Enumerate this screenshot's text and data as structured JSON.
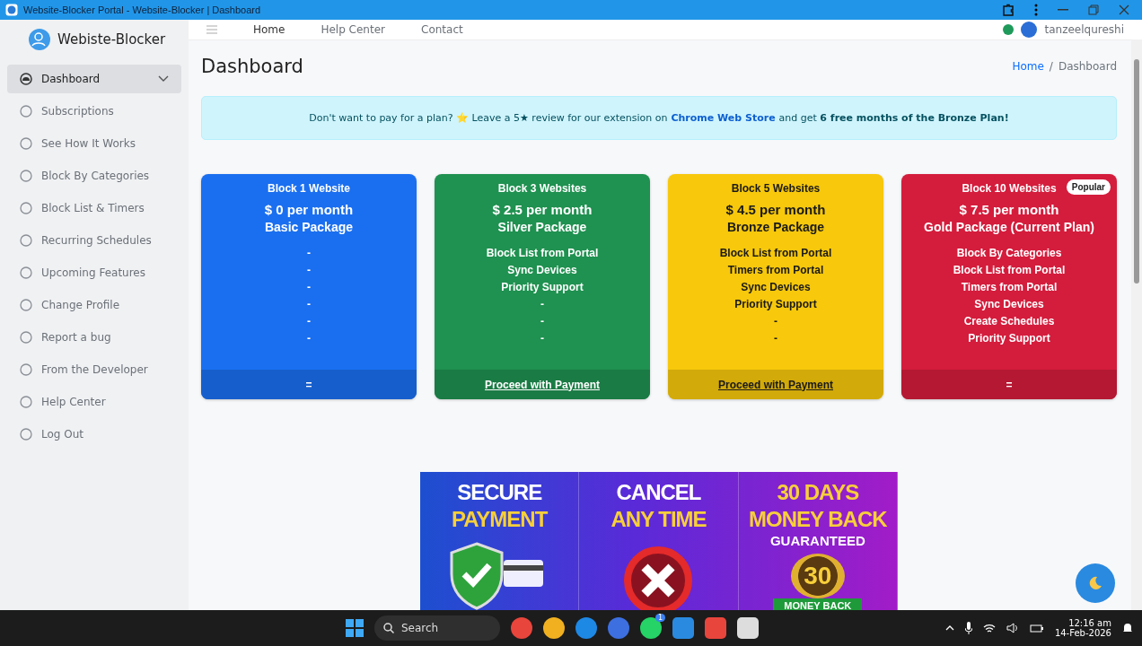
{
  "browser": {
    "title": "Website-Blocker Portal - Website-Blocker | Dashboard"
  },
  "sidebar": {
    "brand": "Webiste-Blocker",
    "items": [
      {
        "label": "Dashboard",
        "selected": true
      },
      {
        "label": "Subscriptions",
        "selected": false
      },
      {
        "label": "See How It Works",
        "selected": false
      },
      {
        "label": "Block By Categories",
        "selected": false
      },
      {
        "label": "Block List & Timers",
        "selected": false
      },
      {
        "label": "Recurring Schedules",
        "selected": false
      },
      {
        "label": "Upcoming Features",
        "selected": false
      },
      {
        "label": "Change Profile",
        "selected": false
      },
      {
        "label": "Report a bug",
        "selected": false
      },
      {
        "label": "From the Developer",
        "selected": false
      },
      {
        "label": "Help Center",
        "selected": false
      },
      {
        "label": "Log Out",
        "selected": false
      }
    ]
  },
  "topnav": {
    "links": [
      "Home",
      "Help Center",
      "Contact"
    ],
    "user": "tanzeelqureshi"
  },
  "page": {
    "title": "Dashboard",
    "breadcrumb": [
      "Home",
      "Dashboard"
    ],
    "separator": "/"
  },
  "notice": {
    "before": "Don't want to pay for a plan? ⭐ Leave a 5★ review for our extension on",
    "link": "Chrome Web Store",
    "after": "and get **6 free months of the Bronze Plan!**"
  },
  "plans": [
    {
      "title": "Block 1 Website",
      "price": "$ 0 per month",
      "package": "Basic Package",
      "color": "#1a6ff0",
      "features": [
        "-",
        "-",
        "-",
        "-",
        "-",
        "-"
      ],
      "footer": {
        "kind": "text",
        "text": "="
      }
    },
    {
      "title": "Block 3 Websites",
      "price": "$ 2.5 per month",
      "package": "Silver Package",
      "color": "#1f9150",
      "features": [
        "Block List from Portal",
        "Sync Devices",
        "Priority Support",
        "-",
        "-",
        "-"
      ],
      "footer": {
        "kind": "link",
        "text": "Proceed with Payment"
      }
    },
    {
      "title": "Block 5 Websites",
      "price": "$ 4.5 per month",
      "package": "Bronze Package",
      "color": "#f7c80c",
      "features": [
        "Block List from Portal",
        "Timers from Portal",
        "Sync Devices",
        "Priority Support",
        "-",
        "-"
      ],
      "footer": {
        "kind": "link",
        "text": "Proceed with Payment"
      }
    },
    {
      "title": "Block 10 Websites",
      "price": "$ 7.5 per month",
      "package": "Gold Package (Current Plan)",
      "color": "#d41c3c",
      "badge": "Popular",
      "features": [
        "Block By Categories",
        "Block List from Portal",
        "Timers from Portal",
        "Sync Devices",
        "Create Schedules",
        "Priority Support"
      ],
      "footer": {
        "kind": "text",
        "text": "="
      }
    }
  ],
  "banner": {
    "panels": [
      {
        "kind": "shield",
        "lines": [
          {
            "text": "SECURE",
            "accent": false
          },
          {
            "text": "PAYMENT",
            "accent": true
          }
        ]
      },
      {
        "kind": "cancel",
        "lines": [
          {
            "text": "CANCEL",
            "accent": false
          },
          {
            "text": "ANY TIME",
            "accent": true
          }
        ]
      },
      {
        "kind": "seal",
        "lines": [
          {
            "text": "30 DAYS",
            "accent": true
          },
          {
            "text": "MONEY BACK",
            "accent": true
          }
        ],
        "sub": "GUARANTEED",
        "seal_number": "30",
        "ribbon": "MONEY BACK"
      }
    ]
  },
  "taskbar": {
    "search": "Search",
    "time": "12:16 am",
    "date": "14-Feb-2026",
    "whatsapp_badge": "1"
  }
}
